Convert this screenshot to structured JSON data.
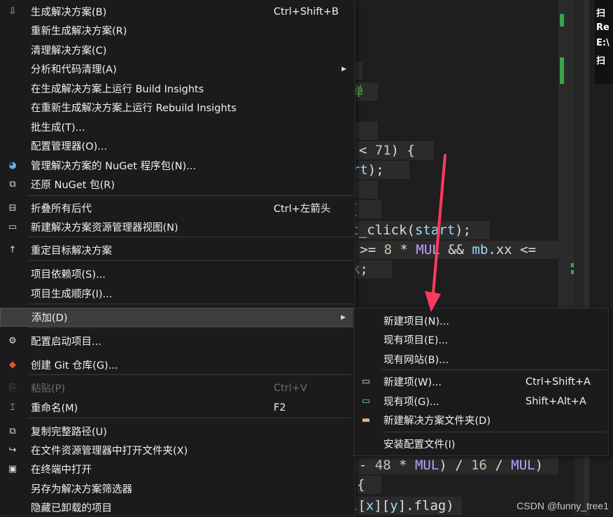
{
  "editor": {
    "code_lines": [
      {
        "parts": [
          {
            "t": ")",
            "c": ""
          }
        ]
      },
      {
        "parts": [
          {
            "t": "弹",
            "c": "c-cmt"
          }
        ]
      },
      {
        "parts": [
          {
            "t": ");",
            "c": ""
          }
        ]
      },
      {
        "parts": [
          {
            "t": "e < ",
            "c": ""
          },
          {
            "t": "71",
            "c": "c-num"
          },
          {
            "t": ") {",
            "c": ""
          }
        ]
      },
      {
        "parts": [
          {
            "t": "tart",
            "c": "c-var"
          },
          {
            "t": ");",
            "c": ""
          }
        ]
      },
      {
        "parts": [
          {
            "t": ";",
            "c": ""
          }
        ]
      },
      {
        "parts": [
          {
            "t": "{",
            "c": ""
          }
        ]
      },
      {
        "parts": [
          {
            "t": "et_click(",
            "c": ""
          },
          {
            "t": "start",
            "c": "c-var"
          },
          {
            "t": ");",
            "c": ""
          }
        ]
      },
      {
        "parts": [
          {
            "t": "xx >= ",
            "c": ""
          },
          {
            "t": "8",
            "c": "c-num"
          },
          {
            "t": " * ",
            "c": ""
          },
          {
            "t": "MUL",
            "c": "c-mac"
          },
          {
            "t": " && ",
            "c": ""
          },
          {
            "t": "mb",
            "c": "c-var"
          },
          {
            "t": ".xx <=",
            "c": ""
          }
        ]
      },
      {
        "parts": [
          {
            "t": "eak",
            "c": "c-kw"
          },
          {
            "t": ";",
            "c": ""
          }
        ]
      },
      {
        "parts": [
          {
            "t": "y - ",
            "c": ""
          },
          {
            "t": "48",
            "c": "c-num"
          },
          {
            "t": " * ",
            "c": ""
          },
          {
            "t": "MUL",
            "c": "c-mac"
          },
          {
            "t": ") / ",
            "c": ""
          },
          {
            "t": "16",
            "c": "c-num"
          },
          {
            "t": " / ",
            "c": ""
          },
          {
            "t": "MUL",
            "c": "c-mac"
          },
          {
            "t": ")",
            "c": ""
          }
        ]
      },
      {
        "parts": [
          {
            "t": "{",
            "c": ""
          }
        ]
      },
      {
        "parts": [
          {
            "t": "l[",
            "c": ""
          },
          {
            "t": "x",
            "c": "c-var"
          },
          {
            "t": "][",
            "c": ""
          },
          {
            "t": "y",
            "c": "c-var"
          },
          {
            "t": "].flag)",
            "c": ""
          }
        ]
      }
    ],
    "right_panel_lines": [
      "扫",
      "Re",
      "E:\\",
      "扫"
    ],
    "watermark": "CSDN @funny_tree1"
  },
  "main_menu": {
    "items": [
      {
        "icon": "build-solution-icon",
        "glyph": "⇩",
        "label": "生成解决方案(B)",
        "shortcut": "Ctrl+Shift+B",
        "submenu": false,
        "disabled": false
      },
      {
        "icon": "",
        "glyph": "",
        "label": "重新生成解决方案(R)",
        "shortcut": "",
        "submenu": false,
        "disabled": false
      },
      {
        "icon": "",
        "glyph": "",
        "label": "清理解决方案(C)",
        "shortcut": "",
        "submenu": false,
        "disabled": false
      },
      {
        "icon": "",
        "glyph": "",
        "label": "分析和代码清理(A)",
        "shortcut": "",
        "submenu": true,
        "disabled": false
      },
      {
        "icon": "",
        "glyph": "",
        "label": "在生成解决方案上运行 Build Insights",
        "shortcut": "",
        "submenu": false,
        "disabled": false
      },
      {
        "icon": "",
        "glyph": "",
        "label": "在重新生成解决方案上运行 Rebuild Insights",
        "shortcut": "",
        "submenu": false,
        "disabled": false
      },
      {
        "icon": "",
        "glyph": "",
        "label": "批生成(T)...",
        "shortcut": "",
        "submenu": false,
        "disabled": false
      },
      {
        "icon": "",
        "glyph": "",
        "label": "配置管理器(O)...",
        "shortcut": "",
        "submenu": false,
        "disabled": false
      },
      {
        "icon": "nuget-icon",
        "glyph": "◕",
        "label": "管理解决方案的 NuGet 程序包(N)...",
        "shortcut": "",
        "submenu": false,
        "disabled": false
      },
      {
        "icon": "restore-nuget-icon",
        "glyph": "⧉",
        "label": "还原 NuGet 包(R)",
        "shortcut": "",
        "submenu": false,
        "disabled": false
      },
      {
        "icon": "collapse-all-icon",
        "glyph": "⊟",
        "label": "折叠所有后代",
        "shortcut": "Ctrl+左箭头",
        "submenu": false,
        "disabled": false
      },
      {
        "icon": "new-explorer-view-icon",
        "glyph": "▭",
        "label": "新建解决方案资源管理器视图(N)",
        "shortcut": "",
        "submenu": false,
        "disabled": false
      },
      {
        "icon": "retarget-icon",
        "glyph": "↑",
        "label": "重定目标解决方案",
        "shortcut": "",
        "submenu": false,
        "disabled": false
      },
      {
        "icon": "",
        "glyph": "",
        "label": "项目依赖项(S)...",
        "shortcut": "",
        "submenu": false,
        "disabled": false
      },
      {
        "icon": "",
        "glyph": "",
        "label": "项目生成顺序(I)...",
        "shortcut": "",
        "submenu": false,
        "disabled": false
      },
      {
        "icon": "",
        "glyph": "",
        "label": "添加(D)",
        "shortcut": "",
        "submenu": true,
        "disabled": false,
        "highlighted": true
      },
      {
        "icon": "gear-icon",
        "glyph": "⚙",
        "label": "配置启动项目...",
        "shortcut": "",
        "submenu": false,
        "disabled": false
      },
      {
        "icon": "git-repo-icon",
        "glyph": "◆",
        "label": "创建 Git 仓库(G)...",
        "shortcut": "",
        "submenu": false,
        "disabled": false
      },
      {
        "icon": "paste-icon",
        "glyph": "⎘",
        "label": "粘贴(P)",
        "shortcut": "Ctrl+V",
        "submenu": false,
        "disabled": true
      },
      {
        "icon": "rename-icon",
        "glyph": "⌶",
        "label": "重命名(M)",
        "shortcut": "F2",
        "submenu": false,
        "disabled": false
      },
      {
        "icon": "copy-path-icon",
        "glyph": "⧉",
        "label": "复制完整路径(U)",
        "shortcut": "",
        "submenu": false,
        "disabled": false
      },
      {
        "icon": "open-folder-icon",
        "glyph": "↪",
        "label": "在文件资源管理器中打开文件夹(X)",
        "shortcut": "",
        "submenu": false,
        "disabled": false
      },
      {
        "icon": "terminal-icon",
        "glyph": "▣",
        "label": "在终端中打开",
        "shortcut": "",
        "submenu": false,
        "disabled": false
      },
      {
        "icon": "",
        "glyph": "",
        "label": "另存为解决方案筛选器",
        "shortcut": "",
        "submenu": false,
        "disabled": false
      },
      {
        "icon": "",
        "glyph": "",
        "label": "隐藏已卸载的项目",
        "shortcut": "",
        "submenu": false,
        "disabled": false
      }
    ]
  },
  "sub_menu": {
    "items": [
      {
        "icon": "",
        "glyph": "",
        "label": "新建项目(N)...",
        "shortcut": ""
      },
      {
        "icon": "",
        "glyph": "",
        "label": "现有项目(E)...",
        "shortcut": ""
      },
      {
        "icon": "",
        "glyph": "",
        "label": "现有网站(B)...",
        "shortcut": ""
      },
      {
        "icon": "new-item-icon",
        "glyph": "▭",
        "label": "新建项(W)...",
        "shortcut": "Ctrl+Shift+A"
      },
      {
        "icon": "existing-item-icon",
        "glyph": "▭",
        "label": "现有项(G)...",
        "shortcut": "Shift+Alt+A"
      },
      {
        "icon": "new-solution-folder-icon",
        "glyph": "▬",
        "label": "新建解决方案文件夹(D)",
        "shortcut": ""
      },
      {
        "icon": "",
        "glyph": "",
        "label": "安装配置文件(I)",
        "shortcut": ""
      }
    ]
  },
  "colors": {
    "menu_bg": "#1b1b1c",
    "highlight": "#3d3d3d",
    "arrow": "#ff3b5c",
    "scroll_marker": "#3aa34a"
  }
}
